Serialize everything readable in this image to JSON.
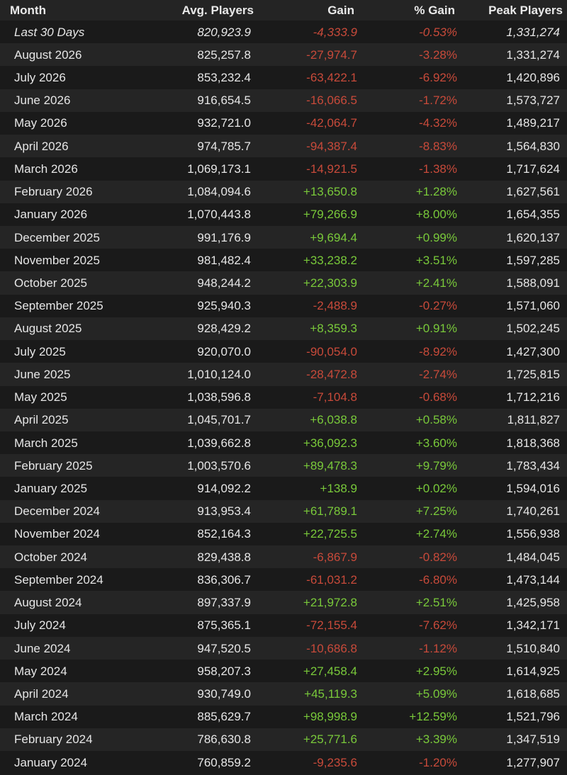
{
  "colors": {
    "positive": "#79c93a",
    "negative": "#c84a3a",
    "text": "#e6e6e6"
  },
  "headers": {
    "month": "Month",
    "avg": "Avg. Players",
    "gain": "Gain",
    "pct": "% Gain",
    "peak": "Peak Players"
  },
  "rows": [
    {
      "month": "Last 30 Days",
      "avg": "820,923.9",
      "gain": "-4,333.9",
      "pct": "-0.53%",
      "peak": "1,331,274",
      "trend": "neg",
      "italic": true
    },
    {
      "month": "August 2026",
      "avg": "825,257.8",
      "gain": "-27,974.7",
      "pct": "-3.28%",
      "peak": "1,331,274",
      "trend": "neg"
    },
    {
      "month": "July 2026",
      "avg": "853,232.4",
      "gain": "-63,422.1",
      "pct": "-6.92%",
      "peak": "1,420,896",
      "trend": "neg"
    },
    {
      "month": "June 2026",
      "avg": "916,654.5",
      "gain": "-16,066.5",
      "pct": "-1.72%",
      "peak": "1,573,727",
      "trend": "neg"
    },
    {
      "month": "May 2026",
      "avg": "932,721.0",
      "gain": "-42,064.7",
      "pct": "-4.32%",
      "peak": "1,489,217",
      "trend": "neg"
    },
    {
      "month": "April 2026",
      "avg": "974,785.7",
      "gain": "-94,387.4",
      "pct": "-8.83%",
      "peak": "1,564,830",
      "trend": "neg"
    },
    {
      "month": "March 2026",
      "avg": "1,069,173.1",
      "gain": "-14,921.5",
      "pct": "-1.38%",
      "peak": "1,717,624",
      "trend": "neg"
    },
    {
      "month": "February 2026",
      "avg": "1,084,094.6",
      "gain": "+13,650.8",
      "pct": "+1.28%",
      "peak": "1,627,561",
      "trend": "pos"
    },
    {
      "month": "January 2026",
      "avg": "1,070,443.8",
      "gain": "+79,266.9",
      "pct": "+8.00%",
      "peak": "1,654,355",
      "trend": "pos"
    },
    {
      "month": "December 2025",
      "avg": "991,176.9",
      "gain": "+9,694.4",
      "pct": "+0.99%",
      "peak": "1,620,137",
      "trend": "pos"
    },
    {
      "month": "November 2025",
      "avg": "981,482.4",
      "gain": "+33,238.2",
      "pct": "+3.51%",
      "peak": "1,597,285",
      "trend": "pos"
    },
    {
      "month": "October 2025",
      "avg": "948,244.2",
      "gain": "+22,303.9",
      "pct": "+2.41%",
      "peak": "1,588,091",
      "trend": "pos"
    },
    {
      "month": "September 2025",
      "avg": "925,940.3",
      "gain": "-2,488.9",
      "pct": "-0.27%",
      "peak": "1,571,060",
      "trend": "neg"
    },
    {
      "month": "August 2025",
      "avg": "928,429.2",
      "gain": "+8,359.3",
      "pct": "+0.91%",
      "peak": "1,502,245",
      "trend": "pos"
    },
    {
      "month": "July 2025",
      "avg": "920,070.0",
      "gain": "-90,054.0",
      "pct": "-8.92%",
      "peak": "1,427,300",
      "trend": "neg"
    },
    {
      "month": "June 2025",
      "avg": "1,010,124.0",
      "gain": "-28,472.8",
      "pct": "-2.74%",
      "peak": "1,725,815",
      "trend": "neg"
    },
    {
      "month": "May 2025",
      "avg": "1,038,596.8",
      "gain": "-7,104.8",
      "pct": "-0.68%",
      "peak": "1,712,216",
      "trend": "neg"
    },
    {
      "month": "April 2025",
      "avg": "1,045,701.7",
      "gain": "+6,038.8",
      "pct": "+0.58%",
      "peak": "1,811,827",
      "trend": "pos"
    },
    {
      "month": "March 2025",
      "avg": "1,039,662.8",
      "gain": "+36,092.3",
      "pct": "+3.60%",
      "peak": "1,818,368",
      "trend": "pos"
    },
    {
      "month": "February 2025",
      "avg": "1,003,570.6",
      "gain": "+89,478.3",
      "pct": "+9.79%",
      "peak": "1,783,434",
      "trend": "pos"
    },
    {
      "month": "January 2025",
      "avg": "914,092.2",
      "gain": "+138.9",
      "pct": "+0.02%",
      "peak": "1,594,016",
      "trend": "pos"
    },
    {
      "month": "December 2024",
      "avg": "913,953.4",
      "gain": "+61,789.1",
      "pct": "+7.25%",
      "peak": "1,740,261",
      "trend": "pos"
    },
    {
      "month": "November 2024",
      "avg": "852,164.3",
      "gain": "+22,725.5",
      "pct": "+2.74%",
      "peak": "1,556,938",
      "trend": "pos"
    },
    {
      "month": "October 2024",
      "avg": "829,438.8",
      "gain": "-6,867.9",
      "pct": "-0.82%",
      "peak": "1,484,045",
      "trend": "neg"
    },
    {
      "month": "September 2024",
      "avg": "836,306.7",
      "gain": "-61,031.2",
      "pct": "-6.80%",
      "peak": "1,473,144",
      "trend": "neg"
    },
    {
      "month": "August 2024",
      "avg": "897,337.9",
      "gain": "+21,972.8",
      "pct": "+2.51%",
      "peak": "1,425,958",
      "trend": "pos"
    },
    {
      "month": "July 2024",
      "avg": "875,365.1",
      "gain": "-72,155.4",
      "pct": "-7.62%",
      "peak": "1,342,171",
      "trend": "neg"
    },
    {
      "month": "June 2024",
      "avg": "947,520.5",
      "gain": "-10,686.8",
      "pct": "-1.12%",
      "peak": "1,510,840",
      "trend": "neg"
    },
    {
      "month": "May 2024",
      "avg": "958,207.3",
      "gain": "+27,458.4",
      "pct": "+2.95%",
      "peak": "1,614,925",
      "trend": "pos"
    },
    {
      "month": "April 2024",
      "avg": "930,749.0",
      "gain": "+45,119.3",
      "pct": "+5.09%",
      "peak": "1,618,685",
      "trend": "pos"
    },
    {
      "month": "March 2024",
      "avg": "885,629.7",
      "gain": "+98,998.9",
      "pct": "+12.59%",
      "peak": "1,521,796",
      "trend": "pos"
    },
    {
      "month": "February 2024",
      "avg": "786,630.8",
      "gain": "+25,771.6",
      "pct": "+3.39%",
      "peak": "1,347,519",
      "trend": "pos"
    },
    {
      "month": "January 2024",
      "avg": "760,859.2",
      "gain": "-9,235.6",
      "pct": "-1.20%",
      "peak": "1,277,907",
      "trend": "neg"
    }
  ]
}
